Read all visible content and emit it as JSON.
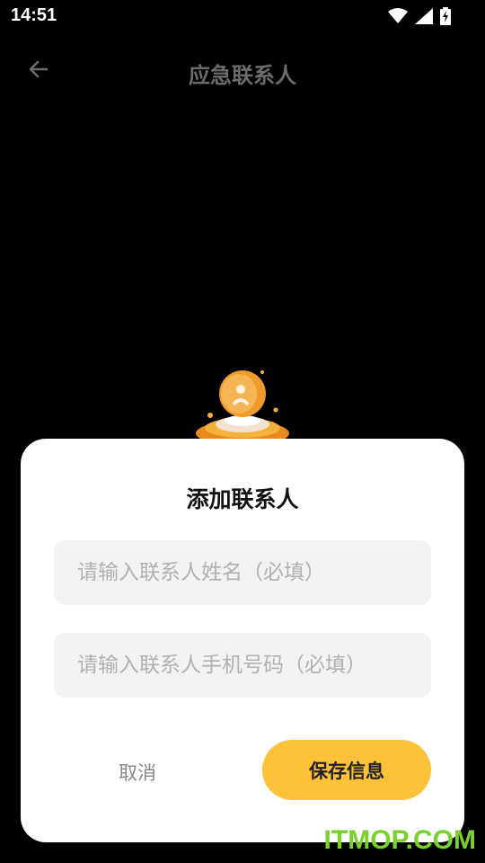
{
  "status_bar": {
    "time": "14:51",
    "icons": [
      "wifi-icon",
      "signal-icon",
      "battery-charging-icon"
    ]
  },
  "app_bar": {
    "title": "应急联系人",
    "back_icon": "arrow-left-icon"
  },
  "dialog": {
    "title": "添加联系人",
    "name_placeholder": "请输入联系人姓名（必填）",
    "name_value": "",
    "phone_placeholder": "请输入联系人手机号码（必填）",
    "phone_value": "",
    "cancel_label": "取消",
    "save_label": "保存信息"
  },
  "watermark": "ITMOP.COM",
  "colors": {
    "background": "#000000",
    "accent": "#fdc13a",
    "card": "#ffffff",
    "input_bg": "#f3f3f3",
    "watermark": "#7ad12e"
  }
}
